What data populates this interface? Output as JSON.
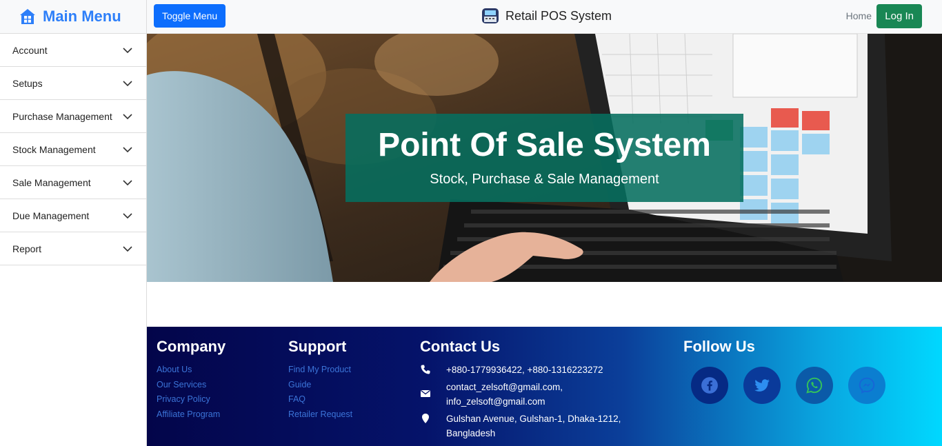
{
  "sidebar": {
    "title": "Main Menu",
    "items": [
      {
        "label": "Account"
      },
      {
        "label": "Setups"
      },
      {
        "label": "Purchase Management"
      },
      {
        "label": "Stock Management"
      },
      {
        "label": "Sale Management"
      },
      {
        "label": "Due Management"
      },
      {
        "label": "Report"
      }
    ]
  },
  "topbar": {
    "toggle_label": "Toggle Menu",
    "brand": "Retail POS System",
    "home_label": "Home",
    "login_label": "Log In"
  },
  "hero": {
    "title": "Point Of Sale System",
    "subtitle": "Stock, Purchase & Sale Management"
  },
  "footer": {
    "company": {
      "heading": "Company",
      "links": [
        "About Us",
        "Our Services",
        "Privacy Policy",
        "Affiliate Program"
      ]
    },
    "support": {
      "heading": "Support",
      "links": [
        "Find My Product",
        "Guide",
        "FAQ",
        "Retailer Request"
      ]
    },
    "contact": {
      "heading": "Contact Us",
      "phone": "+880-1779936422, +880-1316223272",
      "email_1": "contact_zelsoft@gmail.com,",
      "email_2": "info_zelsoft@gmail.com",
      "address_1": "Gulshan Avenue, Gulshan-1, Dhaka-1212,",
      "address_2": "Bangladesh"
    },
    "follow": {
      "heading": "Follow Us",
      "icons": [
        "facebook-icon",
        "twitter-icon",
        "whatsapp-icon",
        "messenger-icon"
      ]
    }
  },
  "colors": {
    "primary": "#0d6efd",
    "success": "#198754",
    "sidebar_title": "#2d7ff9",
    "hero_box": "#066e5f",
    "footer_link": "#3b74d8"
  }
}
